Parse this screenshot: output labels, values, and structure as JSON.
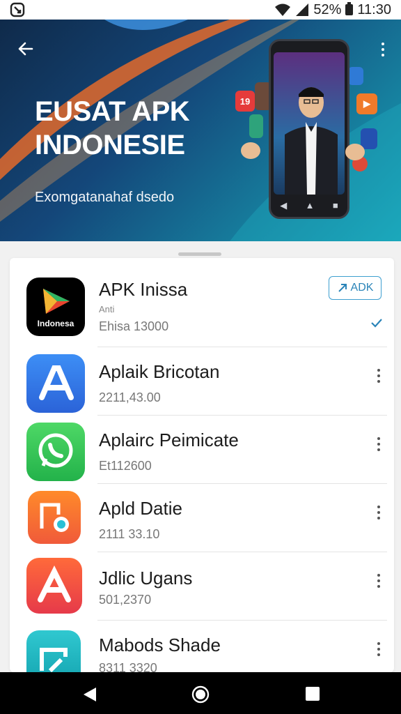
{
  "status_bar": {
    "battery_text": "52%",
    "time": "11:30",
    "icons": [
      "app-notification-icon",
      "wifi-icon",
      "signal-icon",
      "battery-icon"
    ]
  },
  "hero": {
    "title_line1": "EUSAT APK",
    "title_line2": "INDONESIE",
    "subtitle": "Exomgatanahaf dsedo",
    "gradient": [
      "#0f2a4a",
      "#14477a",
      "#167f9e",
      "#1aa3b8"
    ]
  },
  "apps": [
    {
      "name": "APK Inissa",
      "small": "Anti",
      "meta": "Ehisa 13000",
      "icon_text": "Indonesa",
      "action_label": "ADK",
      "icon": "play-store-icon"
    },
    {
      "name": "Aplaik Bricotan",
      "meta": "2211,43.00",
      "icon": "app-store-a-icon"
    },
    {
      "name": "Aplairc Peimicate",
      "meta": "Et112600",
      "icon": "whatsapp-icon"
    },
    {
      "name": "Apld Datie",
      "meta": "2111 33.10",
      "icon": "music-app-icon"
    },
    {
      "name": "Jdlic Ugans",
      "meta": "501,2370",
      "icon": "a-logo-icon"
    },
    {
      "name": "Mabods Shade",
      "meta": "8311 3320",
      "icon": "folder-app-icon"
    }
  ],
  "colors": {
    "accent": "#2a84b8",
    "sheet_bg": "#ffffff"
  }
}
